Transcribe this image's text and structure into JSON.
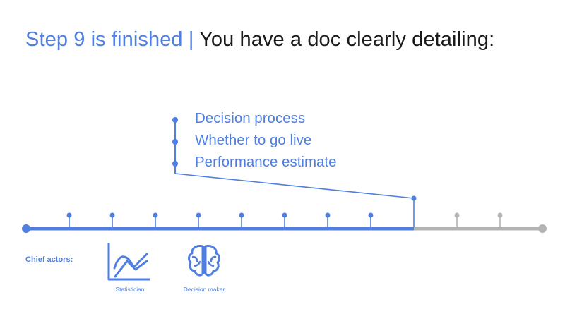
{
  "title": {
    "prefix": "Step 9 is finished |",
    "main": "You have a doc clearly detailing:"
  },
  "bullets": [
    "Decision process",
    "Whether to go live",
    "Performance estimate"
  ],
  "timeline": {
    "total_steps": 13,
    "completed_steps": 10,
    "active_color": "#4f7fe0",
    "inactive_color": "#b3b3b3"
  },
  "actors": {
    "label": "Chief actors:",
    "items": [
      {
        "name": "Statistician",
        "icon": "chart-icon"
      },
      {
        "name": "Decision maker",
        "icon": "brain-icon"
      }
    ]
  },
  "colors": {
    "accent": "#4f7fe0",
    "text": "#1a1a1a",
    "inactive": "#b3b3b3"
  }
}
